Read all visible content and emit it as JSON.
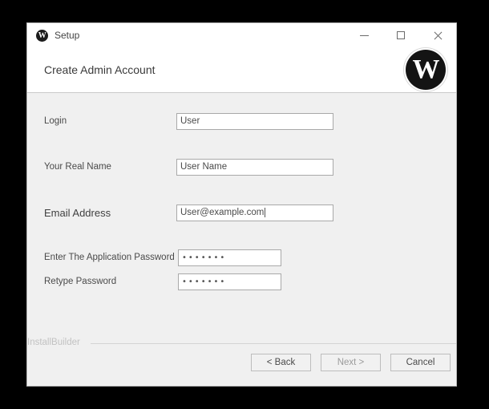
{
  "window": {
    "titlebar": {
      "logo_icon": "wordpress-icon",
      "title": "Setup",
      "minimize_label": "minimize-icon",
      "maximize_label": "maximize-icon",
      "close_label": "close-icon"
    },
    "header": {
      "title": "Create Admin Account",
      "logo_letter": "W",
      "logo_icon": "wordpress-logo"
    },
    "form": {
      "fields": [
        {
          "label": "Login",
          "value": "User",
          "type": "text",
          "width": "wide"
        },
        {
          "label": "Your Real Name",
          "value": "User Name",
          "type": "text",
          "width": "wide"
        },
        {
          "label": "Email Address",
          "value": "User@example.com",
          "type": "text",
          "width": "wide"
        },
        {
          "label": "Enter The Application Password",
          "value": "•••••••",
          "type": "password",
          "width": "narrow"
        },
        {
          "label": "Retype Password",
          "value": "•••••••",
          "type": "password",
          "width": "narrow"
        }
      ]
    },
    "footer": {
      "brand": "InstallBuilder",
      "buttons": [
        {
          "label": "< Back",
          "state": "enabled"
        },
        {
          "label": "Next >",
          "state": "disabled"
        },
        {
          "label": "Cancel",
          "state": "enabled"
        }
      ]
    }
  },
  "colors": {
    "window_bg": "#f0f0f0",
    "header_bg": "#ffffff",
    "accent": "#1c1c1c",
    "border": "#a9a9a9",
    "desktop": "#000000"
  }
}
